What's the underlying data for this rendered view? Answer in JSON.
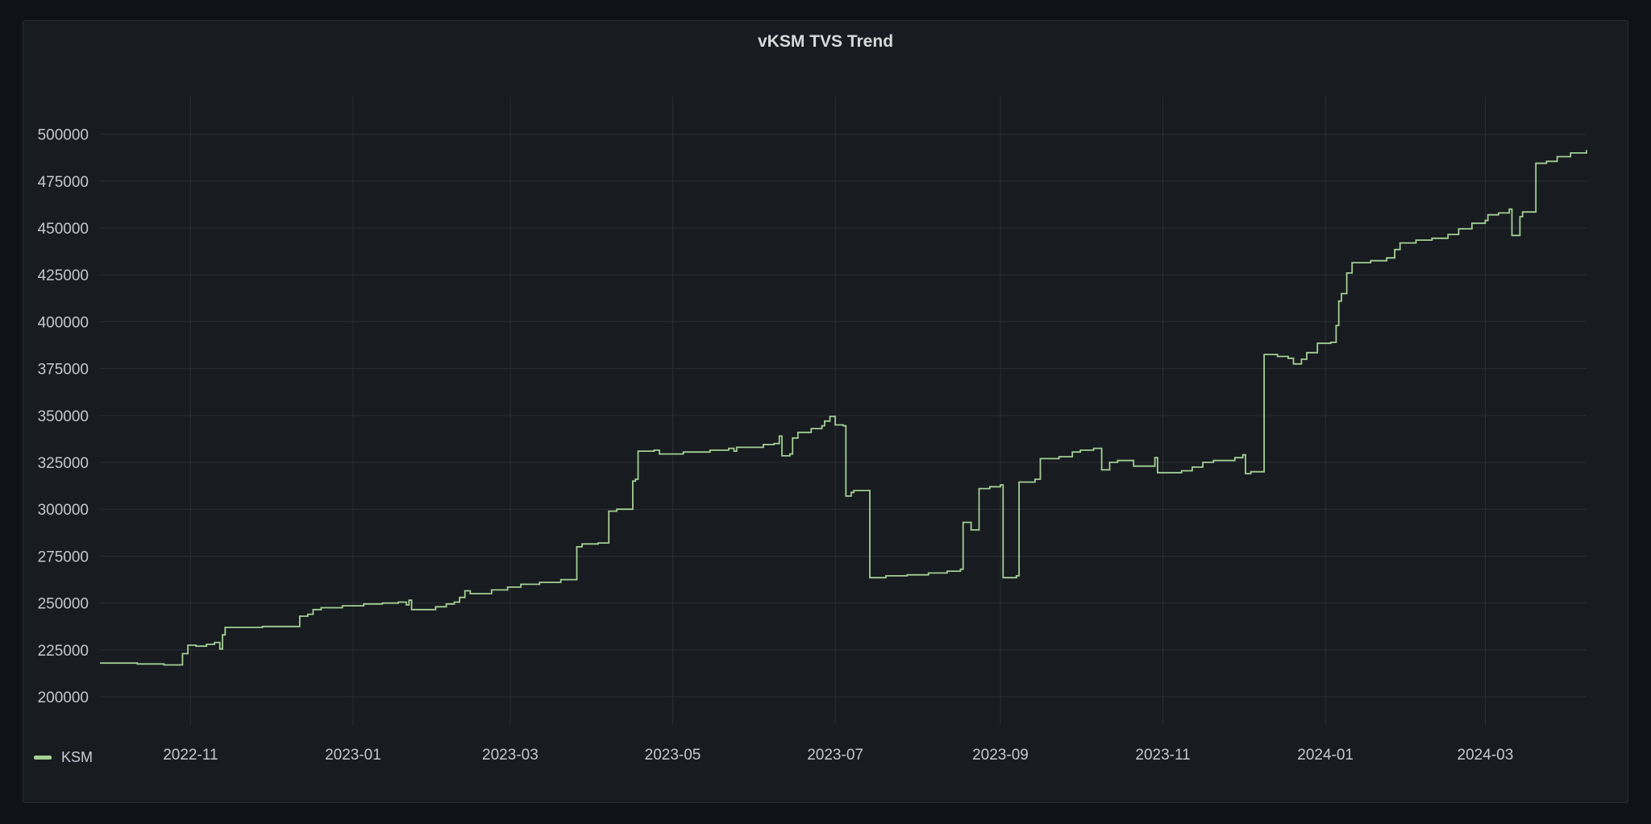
{
  "panel": {
    "title": "vKSM TVS Trend"
  },
  "colors": {
    "series": "#a3cf95",
    "grid": "#2b2e33",
    "tick_text": "#c7c8cc"
  },
  "chart_data": {
    "type": "line",
    "title": "vKSM TVS Trend",
    "xlabel": "",
    "ylabel": "",
    "x_axis_type": "time",
    "xlim": [
      "2022-09-28",
      "2024-04-08"
    ],
    "ylim": [
      185000,
      520000
    ],
    "x_ticks": [
      "2022-11",
      "2023-01",
      "2023-03",
      "2023-05",
      "2023-07",
      "2023-09",
      "2023-11",
      "2024-01",
      "2024-03"
    ],
    "y_ticks": [
      200000,
      225000,
      250000,
      275000,
      300000,
      325000,
      350000,
      375000,
      400000,
      425000,
      450000,
      475000,
      500000
    ],
    "grid": true,
    "legend_position": "bottom-left",
    "series": [
      {
        "name": "KSM",
        "color": "#a3cf95",
        "step": true,
        "points": [
          [
            "2022-09-28",
            218000
          ],
          [
            "2022-10-08",
            218000
          ],
          [
            "2022-10-12",
            217500
          ],
          [
            "2022-10-20",
            217500
          ],
          [
            "2022-10-22",
            217000
          ],
          [
            "2022-10-28",
            217000
          ],
          [
            "2022-10-29",
            223000
          ],
          [
            "2022-10-31",
            227500
          ],
          [
            "2022-11-03",
            227000
          ],
          [
            "2022-11-07",
            228000
          ],
          [
            "2022-11-10",
            229000
          ],
          [
            "2022-11-12",
            225500
          ],
          [
            "2022-11-13",
            233000
          ],
          [
            "2022-11-14",
            237000
          ],
          [
            "2022-11-25",
            237000
          ],
          [
            "2022-11-28",
            237500
          ],
          [
            "2022-12-10",
            237500
          ],
          [
            "2022-12-12",
            243000
          ],
          [
            "2022-12-15",
            244000
          ],
          [
            "2022-12-17",
            246500
          ],
          [
            "2022-12-20",
            247500
          ],
          [
            "2022-12-28",
            248500
          ],
          [
            "2023-01-05",
            249500
          ],
          [
            "2023-01-12",
            250000
          ],
          [
            "2023-01-18",
            250500
          ],
          [
            "2023-01-21",
            249000
          ],
          [
            "2023-01-22",
            251500
          ],
          [
            "2023-01-23",
            246500
          ],
          [
            "2023-01-28",
            246500
          ],
          [
            "2023-02-01",
            248000
          ],
          [
            "2023-02-05",
            249500
          ],
          [
            "2023-02-08",
            250500
          ],
          [
            "2023-02-10",
            253000
          ],
          [
            "2023-02-12",
            256500
          ],
          [
            "2023-02-14",
            255000
          ],
          [
            "2023-02-22",
            257000
          ],
          [
            "2023-02-28",
            258500
          ],
          [
            "2023-03-05",
            260000
          ],
          [
            "2023-03-12",
            261000
          ],
          [
            "2023-03-20",
            262500
          ],
          [
            "2023-03-25",
            262500
          ],
          [
            "2023-03-26",
            280000
          ],
          [
            "2023-03-28",
            281500
          ],
          [
            "2023-04-03",
            282000
          ],
          [
            "2023-04-06",
            282000
          ],
          [
            "2023-04-07",
            299000
          ],
          [
            "2023-04-10",
            300000
          ],
          [
            "2023-04-15",
            300000
          ],
          [
            "2023-04-16",
            315000
          ],
          [
            "2023-04-17",
            316000
          ],
          [
            "2023-04-18",
            331000
          ],
          [
            "2023-04-24",
            331500
          ],
          [
            "2023-04-26",
            329500
          ],
          [
            "2023-05-05",
            330500
          ],
          [
            "2023-05-15",
            331500
          ],
          [
            "2023-05-22",
            332500
          ],
          [
            "2023-05-24",
            331000
          ],
          [
            "2023-05-25",
            333000
          ],
          [
            "2023-06-04",
            334500
          ],
          [
            "2023-06-08",
            335000
          ],
          [
            "2023-06-10",
            339000
          ],
          [
            "2023-06-11",
            328500
          ],
          [
            "2023-06-14",
            329500
          ],
          [
            "2023-06-15",
            338000
          ],
          [
            "2023-06-17",
            341000
          ],
          [
            "2023-06-22",
            343000
          ],
          [
            "2023-06-26",
            344500
          ],
          [
            "2023-06-27",
            347000
          ],
          [
            "2023-06-29",
            349500
          ],
          [
            "2023-07-01",
            345000
          ],
          [
            "2023-07-04",
            344500
          ],
          [
            "2023-07-05",
            307000
          ],
          [
            "2023-07-07",
            309000
          ],
          [
            "2023-07-08",
            310000
          ],
          [
            "2023-07-13",
            310000
          ],
          [
            "2023-07-14",
            263500
          ],
          [
            "2023-07-20",
            264500
          ],
          [
            "2023-07-28",
            265000
          ],
          [
            "2023-08-05",
            266000
          ],
          [
            "2023-08-12",
            267000
          ],
          [
            "2023-08-17",
            268000
          ],
          [
            "2023-08-18",
            293000
          ],
          [
            "2023-08-21",
            289000
          ],
          [
            "2023-08-24",
            311000
          ],
          [
            "2023-08-28",
            312000
          ],
          [
            "2023-09-01",
            313000
          ],
          [
            "2023-09-02",
            263500
          ],
          [
            "2023-09-07",
            264500
          ],
          [
            "2023-09-08",
            314500
          ],
          [
            "2023-09-14",
            316000
          ],
          [
            "2023-09-16",
            327000
          ],
          [
            "2023-09-23",
            328000
          ],
          [
            "2023-09-28",
            330500
          ],
          [
            "2023-10-01",
            331500
          ],
          [
            "2023-10-06",
            332500
          ],
          [
            "2023-10-09",
            321000
          ],
          [
            "2023-10-12",
            325000
          ],
          [
            "2023-10-15",
            326000
          ],
          [
            "2023-10-21",
            323000
          ],
          [
            "2023-10-28",
            323000
          ],
          [
            "2023-10-29",
            327500
          ],
          [
            "2023-10-30",
            319500
          ],
          [
            "2023-11-08",
            320500
          ],
          [
            "2023-11-12",
            322500
          ],
          [
            "2023-11-16",
            325000
          ],
          [
            "2023-11-20",
            326000
          ],
          [
            "2023-11-28",
            327500
          ],
          [
            "2023-12-01",
            329000
          ],
          [
            "2023-12-02",
            319000
          ],
          [
            "2023-12-04",
            320000
          ],
          [
            "2023-12-08",
            320000
          ],
          [
            "2023-12-09",
            382500
          ],
          [
            "2023-12-14",
            381500
          ],
          [
            "2023-12-18",
            380500
          ],
          [
            "2023-12-20",
            377500
          ],
          [
            "2023-12-23",
            380000
          ],
          [
            "2023-12-25",
            383500
          ],
          [
            "2023-12-29",
            388500
          ],
          [
            "2024-01-03",
            389000
          ],
          [
            "2024-01-05",
            398000
          ],
          [
            "2024-01-06",
            411000
          ],
          [
            "2024-01-07",
            415000
          ],
          [
            "2024-01-09",
            426000
          ],
          [
            "2024-01-11",
            431500
          ],
          [
            "2024-01-18",
            432500
          ],
          [
            "2024-01-24",
            434000
          ],
          [
            "2024-01-27",
            438500
          ],
          [
            "2024-01-29",
            442000
          ],
          [
            "2024-02-04",
            443500
          ],
          [
            "2024-02-10",
            444500
          ],
          [
            "2024-02-16",
            446500
          ],
          [
            "2024-02-20",
            449500
          ],
          [
            "2024-02-25",
            452500
          ],
          [
            "2024-03-01",
            454000
          ],
          [
            "2024-03-02",
            457000
          ],
          [
            "2024-03-06",
            458000
          ],
          [
            "2024-03-10",
            460000
          ],
          [
            "2024-03-11",
            446000
          ],
          [
            "2024-03-14",
            456000
          ],
          [
            "2024-03-15",
            458500
          ],
          [
            "2024-03-19",
            458500
          ],
          [
            "2024-03-20",
            484500
          ],
          [
            "2024-03-24",
            485500
          ],
          [
            "2024-03-28",
            488000
          ],
          [
            "2024-04-02",
            490000
          ],
          [
            "2024-04-08",
            491500
          ]
        ]
      }
    ]
  },
  "legend": {
    "label": "KSM"
  }
}
